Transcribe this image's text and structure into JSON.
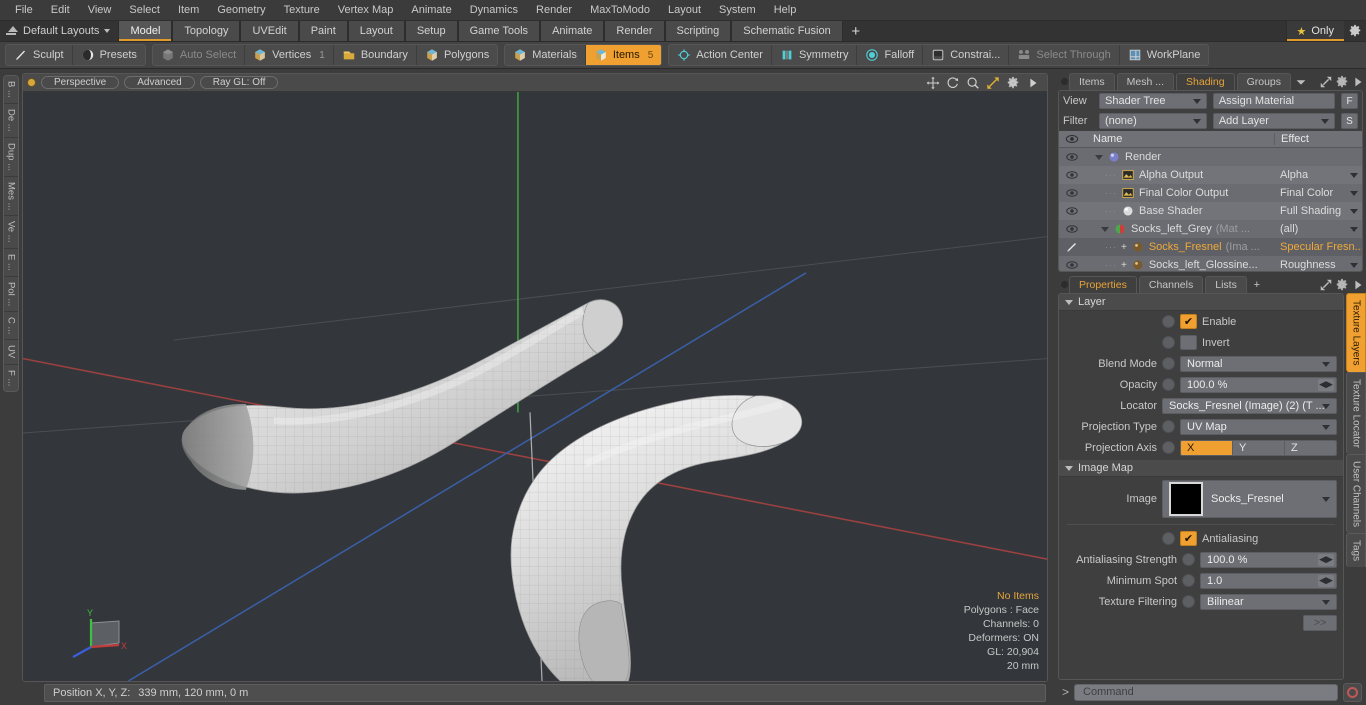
{
  "menubar": {
    "items": [
      "File",
      "Edit",
      "View",
      "Select",
      "Item",
      "Geometry",
      "Texture",
      "Vertex Map",
      "Animate",
      "Dynamics",
      "Render",
      "MaxToModo",
      "Layout",
      "System",
      "Help"
    ]
  },
  "layoutbar": {
    "layout_label": "Default Layouts",
    "tabs": [
      "Model",
      "Topology",
      "UVEdit",
      "Paint",
      "Layout",
      "Setup",
      "Game Tools",
      "Animate",
      "Render",
      "Scripting",
      "Schematic Fusion"
    ],
    "active_tab": "Model",
    "plus_label": "+",
    "only_label": "Only",
    "star_glyph": "★",
    "gear_name": "gear-icon"
  },
  "toolbar": {
    "left_group": [
      {
        "label": "Sculpt",
        "icon": "sculpt-brush-icon",
        "state": "normal",
        "badge": ""
      },
      {
        "label": "Presets",
        "icon": "presets-sphere-icon",
        "state": "normal",
        "badge": ""
      }
    ],
    "select_group": [
      {
        "label": "Auto Select",
        "icon": "cube-grey-icon",
        "state": "dim",
        "badge": ""
      },
      {
        "label": "Vertices",
        "icon": "cube-vertices-icon",
        "state": "normal",
        "badge": "1"
      },
      {
        "label": "Boundary",
        "icon": "boundary-icon",
        "state": "normal",
        "badge": ""
      },
      {
        "label": "Polygons",
        "icon": "cube-polygons-icon",
        "state": "normal",
        "badge": ""
      }
    ],
    "items_group": [
      {
        "label": "Materials",
        "icon": "cube-materials-icon",
        "state": "normal",
        "badge": ""
      },
      {
        "label": "Items",
        "icon": "cube-items-icon",
        "state": "on",
        "badge": "5"
      }
    ],
    "right_group": [
      {
        "label": "Action Center",
        "icon": "action-center-icon",
        "state": "normal",
        "badge": ""
      },
      {
        "label": "Symmetry",
        "icon": "symmetry-icon",
        "state": "normal",
        "badge": ""
      },
      {
        "label": "Falloff",
        "icon": "falloff-icon",
        "state": "normal",
        "badge": ""
      },
      {
        "label": "Constrai...",
        "icon": "constraint-icon",
        "state": "normal",
        "badge": ""
      },
      {
        "label": "Select Through",
        "icon": "select-through-icon",
        "state": "dim",
        "badge": ""
      },
      {
        "label": "WorkPlane",
        "icon": "workplane-icon",
        "state": "normal",
        "badge": ""
      }
    ]
  },
  "left_rail": {
    "tabs": [
      "B ...",
      "De ...",
      "Dup ...",
      "Mes ...",
      "Ve ...",
      "E ...",
      "Pol ...",
      "C ...",
      "UV",
      "F ..."
    ]
  },
  "viewport": {
    "mode_dot": "active-indicator",
    "buttons": [
      "Perspective",
      "Advanced",
      "Ray GL: Off"
    ],
    "icons": [
      "move-icon",
      "rotate-icon",
      "zoom-icon",
      "maximize-icon",
      "gear-icon",
      "play-arrow-icon"
    ],
    "stats": {
      "selection": "No Items",
      "lines": [
        "Polygons : Face",
        "Channels: 0",
        "Deformers: ON",
        "GL: 20,904",
        "20 mm"
      ]
    },
    "gizmo": {
      "x": "X",
      "y": "Y",
      "z": "Z"
    }
  },
  "statusbar": {
    "position_label": "Position X, Y, Z:",
    "position_value": "339 mm, 120 mm, 0 m"
  },
  "right_panel": {
    "tabs": [
      {
        "label": "Items",
        "active": false
      },
      {
        "label": "Mesh ...",
        "active": false
      },
      {
        "label": "Shading",
        "active": true
      },
      {
        "label": "Groups",
        "active": false
      }
    ],
    "tab_tools": [
      "chevron-down-icon",
      "expand-icon",
      "gear-icon",
      "play-arrow-icon"
    ],
    "view_row": {
      "label": "View",
      "value": "Shader Tree",
      "button": "Assign Material",
      "key": "F"
    },
    "filter_row": {
      "label": "Filter",
      "value": "(none)",
      "button": "Add Layer",
      "key": "S"
    },
    "tree_headers": {
      "eye": "eye-icon",
      "name": "Name",
      "effect": "Effect"
    },
    "tree_rows": [
      {
        "eye": true,
        "indent": 0,
        "expander": true,
        "icon": "render-globe-icon",
        "name": "Render",
        "suffix": "",
        "effect": "",
        "selected": false,
        "plus": false
      },
      {
        "eye": true,
        "indent": 1,
        "expander": false,
        "icon": "image-output-icon",
        "name": "Alpha Output",
        "suffix": "",
        "effect": "Alpha",
        "selected": false,
        "plus": false
      },
      {
        "eye": true,
        "indent": 1,
        "expander": false,
        "icon": "image-output-icon",
        "name": "Final Color Output",
        "suffix": "",
        "effect": "Final Color",
        "selected": false,
        "plus": false
      },
      {
        "eye": true,
        "indent": 1,
        "expander": false,
        "icon": "base-shader-icon",
        "name": "Base Shader",
        "suffix": "",
        "effect": "Full Shading",
        "selected": false,
        "plus": false
      },
      {
        "eye": true,
        "indent": 1,
        "expander": true,
        "icon": "material-sphere-icon",
        "name": "Socks_left_Grey",
        "suffix": "(Mat ...",
        "effect": "(all)",
        "selected": false,
        "plus": false
      },
      {
        "eye": false,
        "indent": 2,
        "expander": false,
        "icon": "texture-sphere-icon",
        "name": "Socks_Fresnel",
        "suffix": "(Ima ...",
        "effect": "Specular Fresn...",
        "selected": true,
        "plus": true
      },
      {
        "eye": true,
        "indent": 2,
        "expander": false,
        "icon": "texture-sphere-icon",
        "name": "Socks_left_Glossine...",
        "suffix": "",
        "effect": "Roughness",
        "selected": false,
        "plus": true
      }
    ],
    "properties": {
      "tabs": [
        {
          "label": "Properties",
          "active": true
        },
        {
          "label": "Channels",
          "active": false
        },
        {
          "label": "Lists",
          "active": false
        }
      ],
      "plus_label": "+",
      "layer_group": {
        "title": "Layer",
        "enable": {
          "label": "Enable",
          "checked": true
        },
        "invert": {
          "label": "Invert",
          "checked": false
        },
        "blend_mode": {
          "label": "Blend Mode",
          "value": "Normal"
        },
        "opacity": {
          "label": "Opacity",
          "value": "100.0 %"
        },
        "locator": {
          "label": "Locator",
          "value": "Socks_Fresnel (Image) (2) (T ..."
        },
        "projection_type": {
          "label": "Projection Type",
          "value": "UV Map"
        },
        "projection_axis": {
          "label": "Projection Axis",
          "options": [
            "X",
            "Y",
            "Z"
          ],
          "selected": "X"
        }
      },
      "image_group": {
        "title": "Image Map",
        "image": {
          "label": "Image",
          "value": "Socks_Fresnel",
          "swatch": "#000000"
        },
        "antialiasing": {
          "label": "Antialiasing",
          "checked": true
        },
        "aa_strength": {
          "label": "Antialiasing Strength",
          "value": "100.0 %"
        },
        "minimum_spot": {
          "label": "Minimum Spot",
          "value": "1.0"
        },
        "texture_filtering": {
          "label": "Texture Filtering",
          "value": "Bilinear"
        },
        "more_button": ">>"
      }
    },
    "side_tabs": [
      {
        "label": "Texture Layers",
        "active": true
      },
      {
        "label": "Texture Locator",
        "active": false
      },
      {
        "label": "User Channels",
        "active": false
      },
      {
        "label": "Tags",
        "active": false
      }
    ]
  },
  "command_bar": {
    "prompt": ">",
    "placeholder": "Command",
    "record_button": "record-icon"
  },
  "colors": {
    "accent_orange": "#f0a030",
    "tab_underline": "#e09b2d",
    "panel_bg": "#3f3f3f",
    "control_grey": "#6d6f74",
    "viewport_bg": "#33373b"
  }
}
